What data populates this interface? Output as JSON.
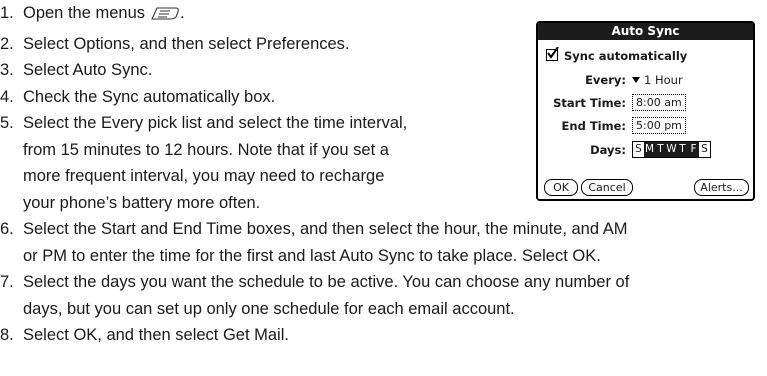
{
  "steps": [
    {
      "num": "1.",
      "lines": [
        "Open the menus"
      ]
    },
    {
      "num": "2.",
      "lines": [
        "Select Options, and then select Preferences."
      ]
    },
    {
      "num": "3.",
      "lines": [
        "Select Auto Sync."
      ]
    },
    {
      "num": "4.",
      "lines": [
        "Check the Sync automatically box."
      ]
    },
    {
      "num": "5.",
      "lines": [
        "Select the Every pick list and select the time interval,",
        "from 15 minutes to 12 hours. Note that if you set a",
        "more frequent interval, you may need to recharge",
        "your phone’s battery more often."
      ]
    },
    {
      "num": "6.",
      "lines": [
        "Select the Start and End Time boxes, and then select the hour, the minute, and AM",
        "or PM to enter the time for the first and last Auto Sync to take place. Select OK."
      ]
    },
    {
      "num": "7.",
      "lines": [
        "Select the days you want the schedule to be active. You can choose any number of",
        "days, but you can set up only one schedule for each email account."
      ]
    },
    {
      "num": "8.",
      "lines": [
        "Select OK, and then select Get Mail."
      ]
    }
  ],
  "dialog": {
    "title": "Auto Sync",
    "checkbox_label": "Sync automatically",
    "checkbox_checked": true,
    "every_label": "Every:",
    "every_value": "1 Hour",
    "start_label": "Start Time:",
    "start_value": "8:00 am",
    "end_label": "End Time:",
    "end_value": "5:00 pm",
    "days_label": "Days:",
    "days": [
      {
        "letter": "S",
        "selected": false
      },
      {
        "letter": "M",
        "selected": true
      },
      {
        "letter": "T",
        "selected": true
      },
      {
        "letter": "W",
        "selected": true
      },
      {
        "letter": "T",
        "selected": true
      },
      {
        "letter": "F",
        "selected": true
      },
      {
        "letter": "S",
        "selected": false
      }
    ],
    "ok_label": "OK",
    "cancel_label": "Cancel",
    "alerts_label": "Alerts..."
  }
}
